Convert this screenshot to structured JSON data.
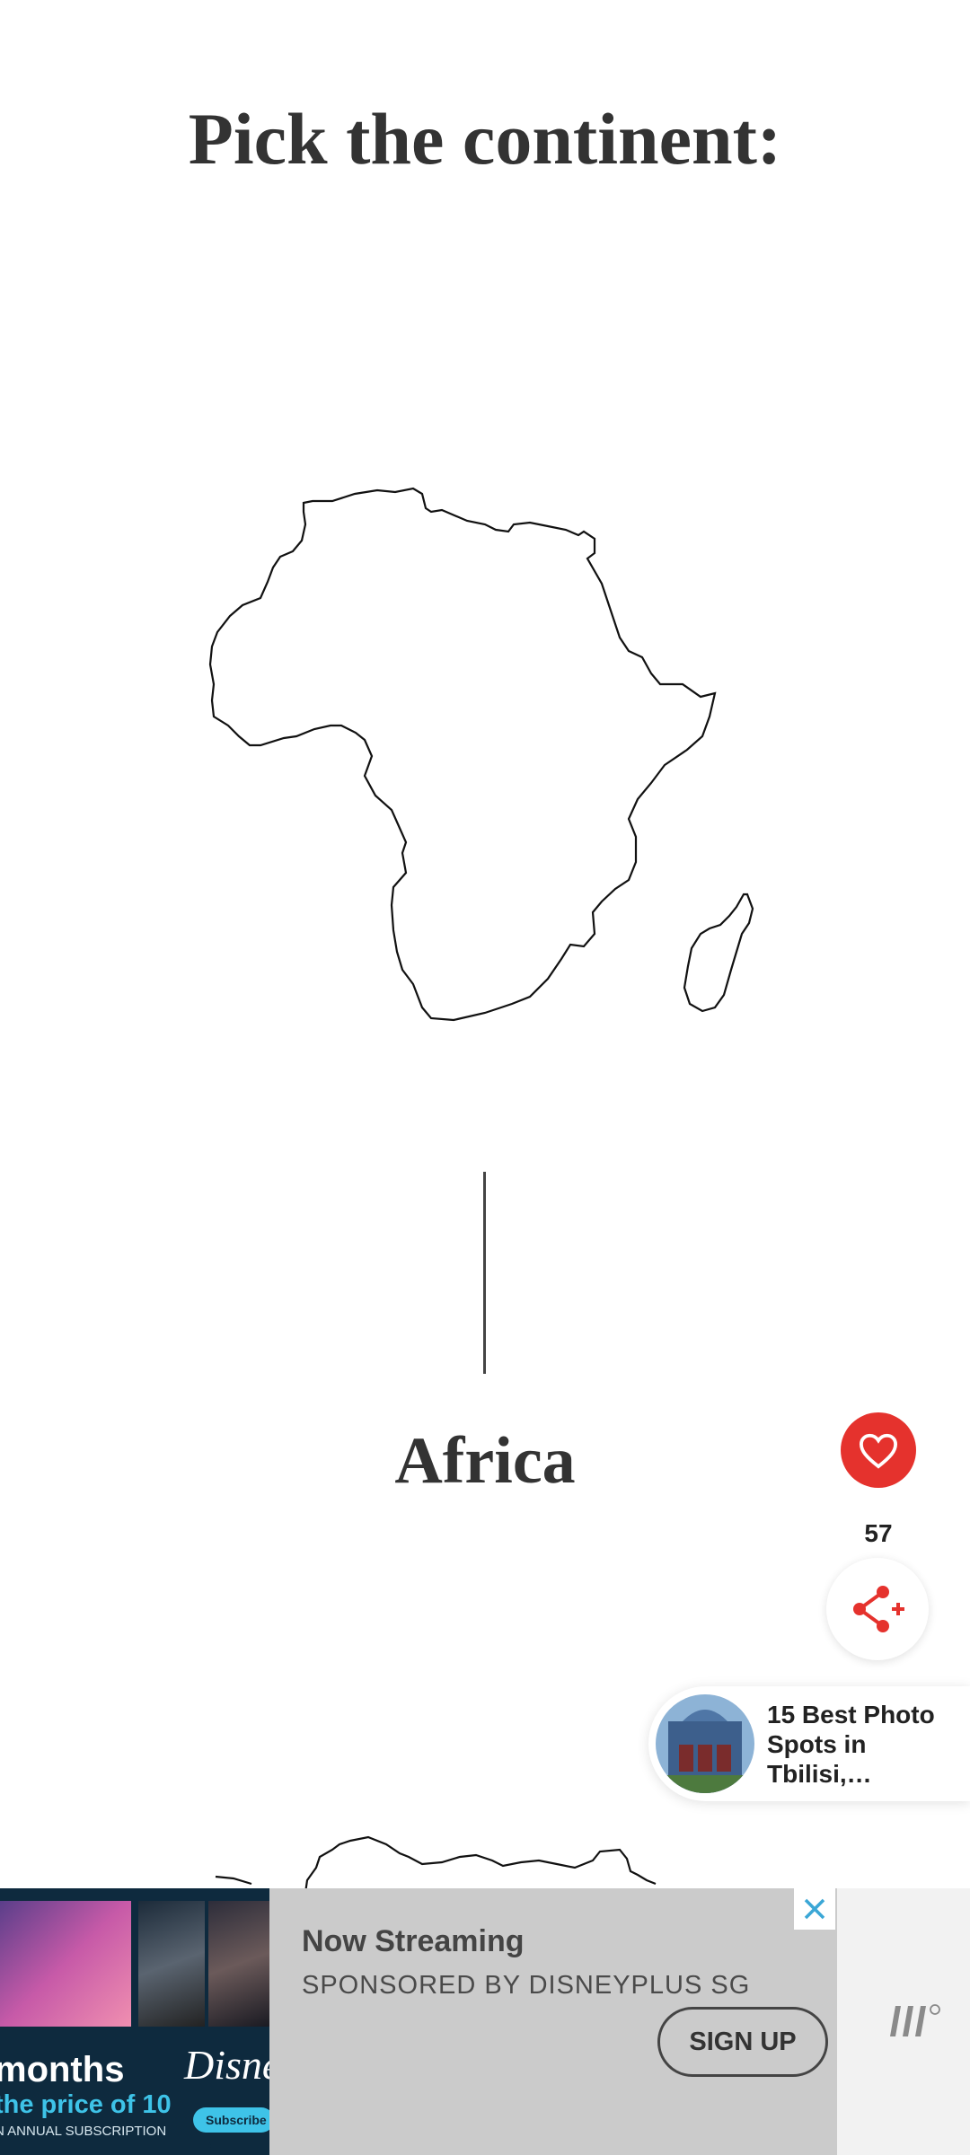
{
  "quiz": {
    "question": "Pick the continent:",
    "answer": "Africa"
  },
  "engagement": {
    "like_count": "57",
    "like_icon": "heart-icon",
    "share_icon": "share-icon"
  },
  "related": {
    "title": "15 Best Photo Spots in Tbilisi,…"
  },
  "ad": {
    "title": "Now Streaming",
    "sponsor": "SPONSORED BY DISNEYPLUS SG",
    "cta": "SIGN UP",
    "image_text": {
      "months": "months",
      "price": "the price of 10",
      "annual": "N ANNUAL SUBSCRIPTION",
      "brand": "Disne",
      "subscribe": "Subscribe N"
    }
  },
  "colors": {
    "accent_red": "#e5322d",
    "ad_cyan": "#3ec3e8"
  }
}
